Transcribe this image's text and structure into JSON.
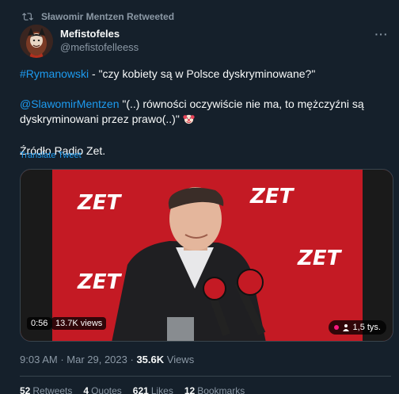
{
  "retweet_header": {
    "text": "Sławomir Mentzen Retweeted",
    "icon": "retweet-icon"
  },
  "author": {
    "display_name": "Mefistofeles",
    "handle": "@mefistofelleess"
  },
  "tweet": {
    "hashtag": "#Rymanowski",
    "line1_rest": " - \"czy kobiety są w Polsce dyskryminowane?\"",
    "mention": "@SlawomirMentzen",
    "quote": " \"(..) równości oczywiście nie ma, to mężczyźni są dyskryminowani przez prawo(..)\" ",
    "source": "Źródło Radio Zet.",
    "translate": "Translate Tweet"
  },
  "media": {
    "logo_text": "ZET",
    "duration": "0:56",
    "views": "13.7K views",
    "viewers": "1,5 tys."
  },
  "meta": {
    "time": "9:03 AM",
    "separator": " · ",
    "date": "Mar 29, 2023",
    "views_count": "35.6K",
    "views_label": " Views"
  },
  "stats": [
    {
      "count": "52",
      "label": "Retweets"
    },
    {
      "count": "4",
      "label": "Quotes"
    },
    {
      "count": "621",
      "label": "Likes"
    },
    {
      "count": "12",
      "label": "Bookmarks"
    }
  ],
  "colors": {
    "background": "#15202b",
    "link": "#1d9bf0",
    "muted": "#8b98a5",
    "brand_red": "#d7212b"
  }
}
